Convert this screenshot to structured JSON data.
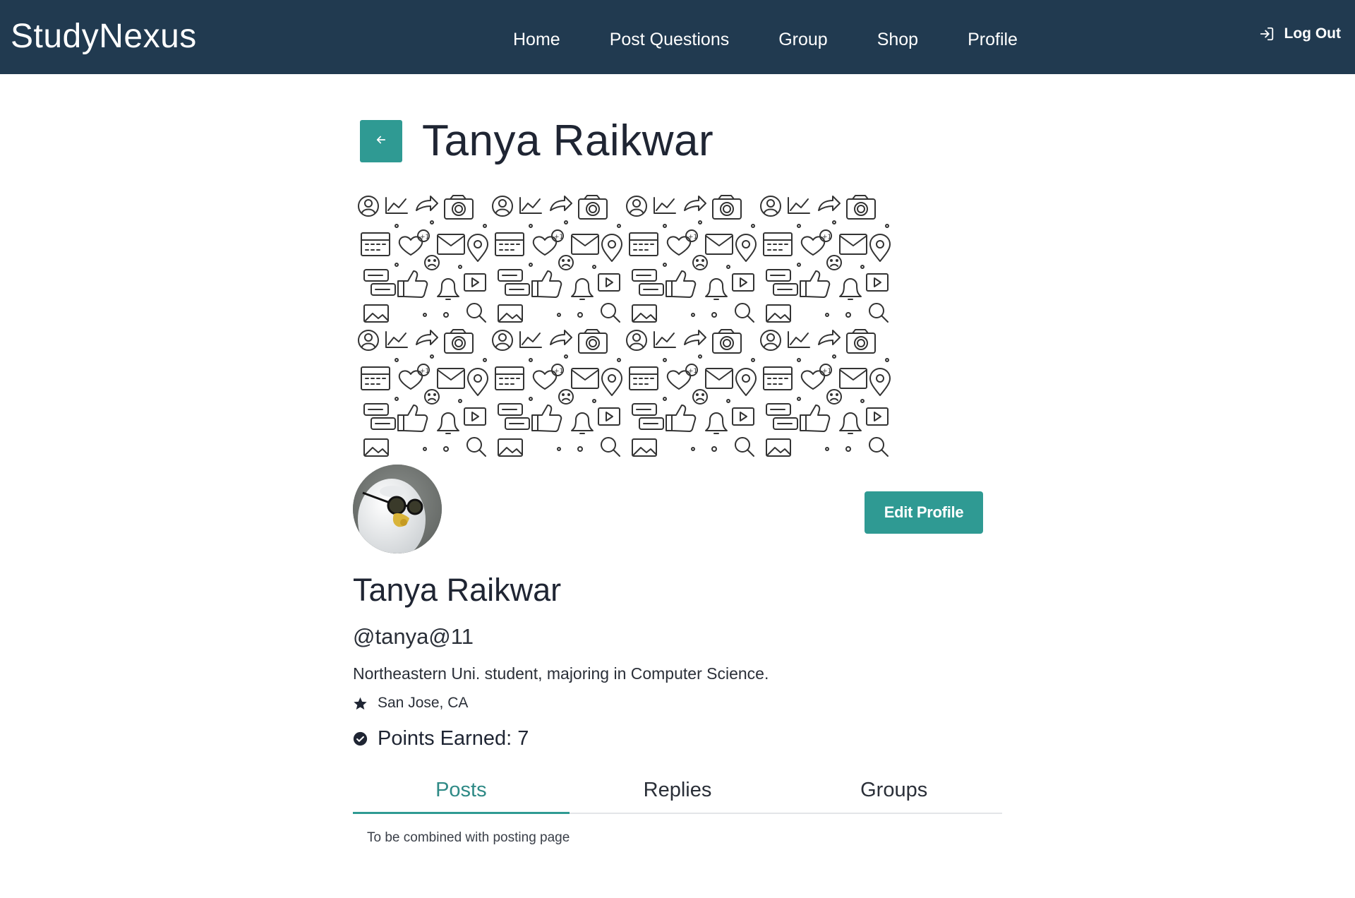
{
  "navbar": {
    "brand": "StudyNexus",
    "links": [
      "Home",
      "Post Questions",
      "Group",
      "Shop",
      "Profile"
    ],
    "logout": "Log Out"
  },
  "header": {
    "title": "Tanya Raikwar"
  },
  "profile": {
    "name": "Tanya Raikwar",
    "handle": "@tanya@11",
    "bio": "Northeastern Uni. student, majoring in Computer Science.",
    "location": "San Jose, CA",
    "points": "Points Earned: 7",
    "edit_label": "Edit Profile"
  },
  "tabs": [
    "Posts",
    "Replies",
    "Groups"
  ],
  "active_tab": "Posts",
  "tab_content": "To be combined with posting page",
  "colors": {
    "navbar": "#213a50",
    "accent": "#2f9a93"
  },
  "icons": {
    "back": "arrow-left-icon",
    "logout": "logout-icon",
    "location": "star-icon",
    "points": "check-circle-icon"
  }
}
